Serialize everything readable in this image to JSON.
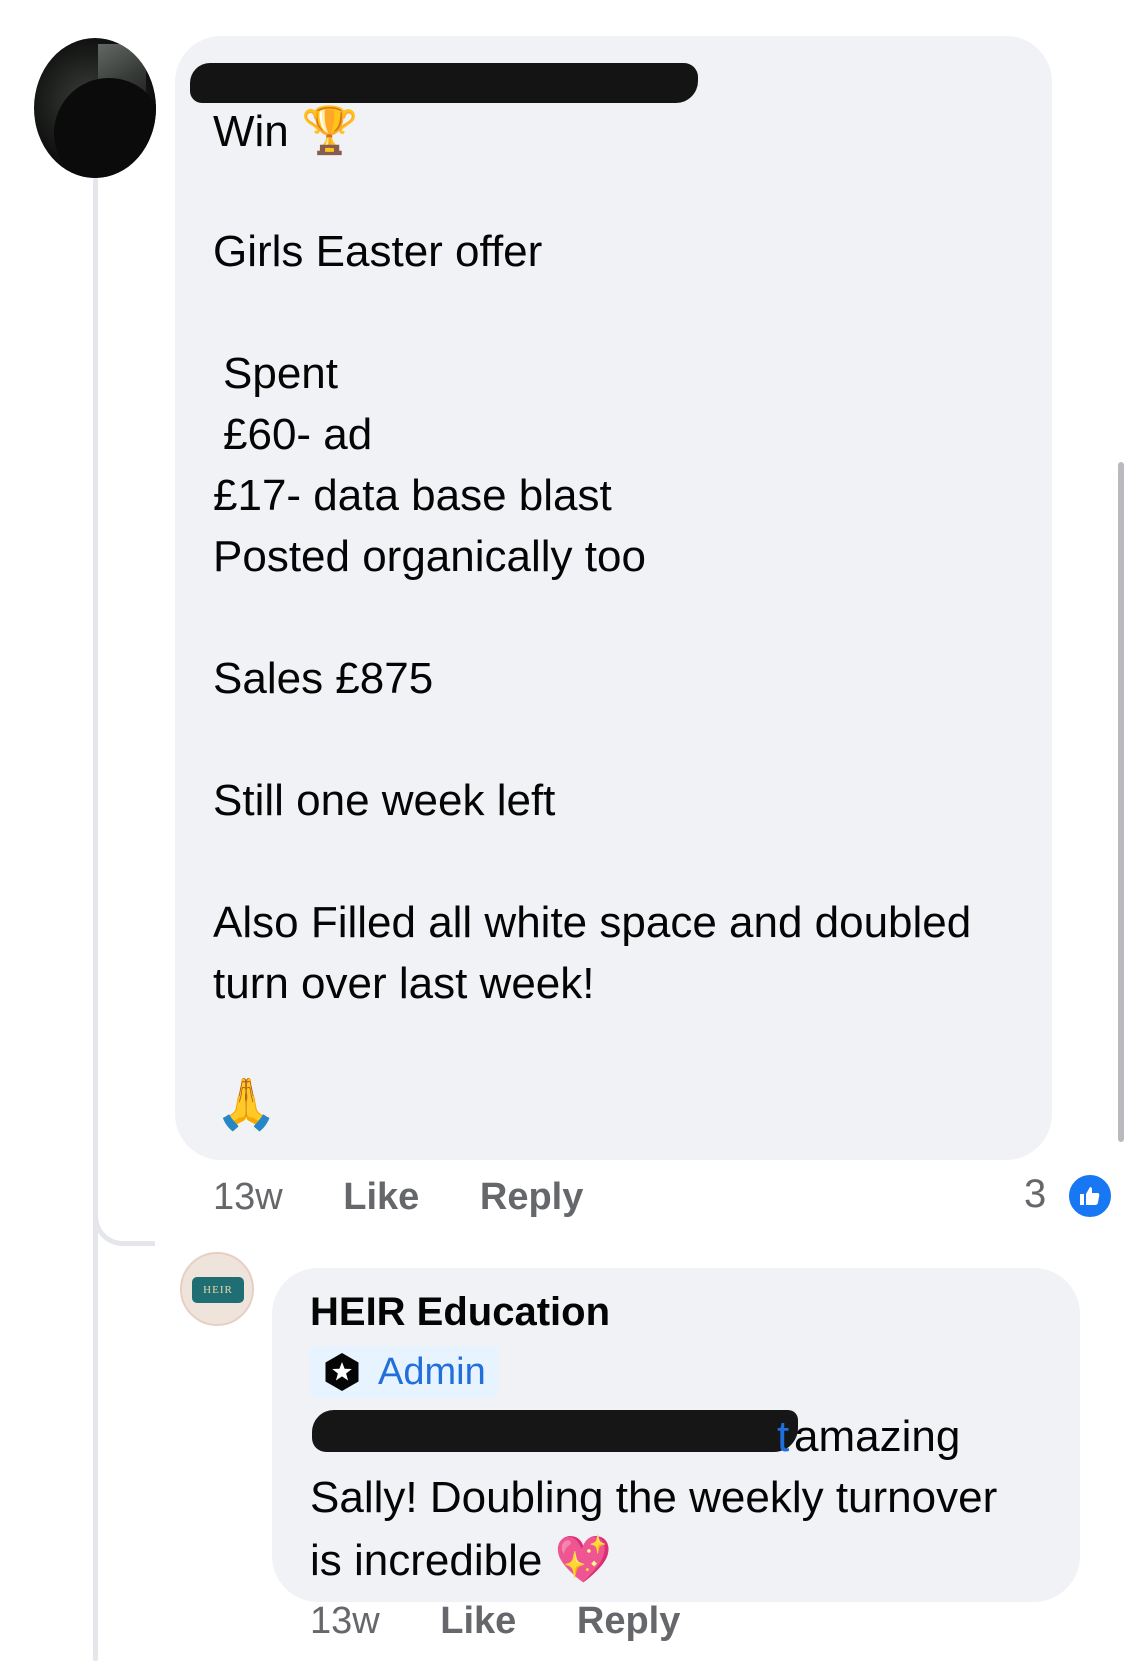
{
  "comment": {
    "lines": {
      "win": "Win",
      "girls_easter_offer": "Girls Easter offer",
      "spent": "Spent",
      "ad": "£60- ad",
      "database": "£17- data base blast",
      "posted": "Posted organically too",
      "sales": "Sales £875",
      "week_left": "Still one week left",
      "also_filled_1": "Also Filled all white space and doubled",
      "also_filled_2": "turn over last week!"
    },
    "emoji": {
      "trophy": "🏆",
      "pray": "🙏"
    },
    "time": "13w",
    "like_label": "Like",
    "reply_label": "Reply",
    "reaction_count": "3"
  },
  "reply": {
    "author": "HEIR Education",
    "avatar_text": "HEIR",
    "role": "Admin",
    "mention_tail": "t",
    "lines": {
      "line1": "amazing",
      "line2": "Sally! Doubling the weekly turnover",
      "line3": "is incredible"
    },
    "heart_emoji": "💖",
    "time": "13w",
    "like_label": "Like",
    "reply_label": "Reply"
  },
  "colors": {
    "bubble": "#f0f2f5",
    "accent": "#1877f2",
    "admin_text": "#216fdb",
    "meta_text": "#65676b"
  }
}
